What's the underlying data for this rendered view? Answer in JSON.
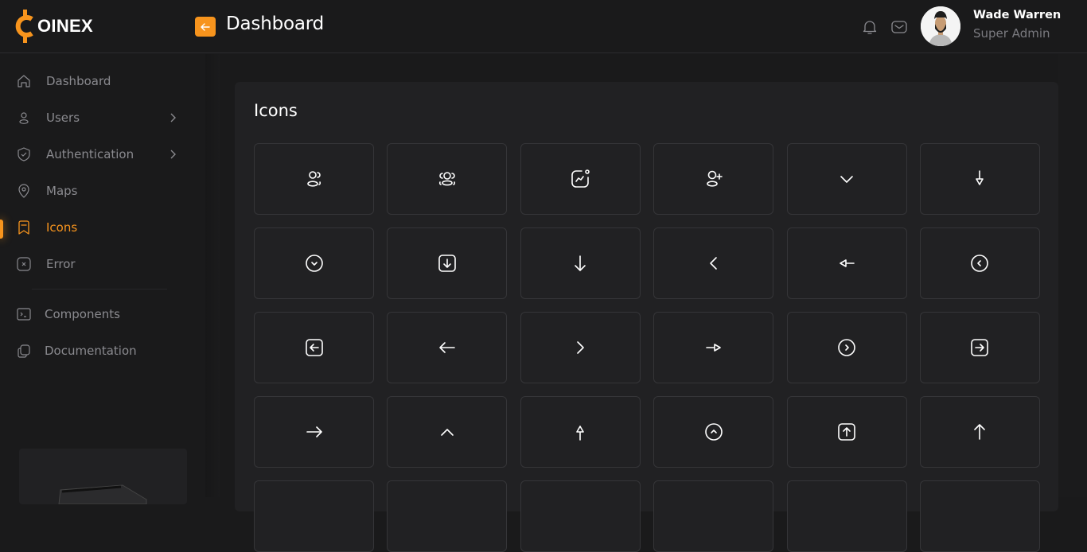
{
  "brand": {
    "name": "OINEX",
    "logo_letter": "C",
    "accent": "#f7941d"
  },
  "header": {
    "title": "Dashboard",
    "back_icon": "arrow-left-icon",
    "notification_icon": "bell-icon",
    "mail_icon": "mail-icon"
  },
  "user": {
    "name": "Wade Warren",
    "role": "Super Admin"
  },
  "sidebar": {
    "items": [
      {
        "label": "Dashboard",
        "icon": "home-icon",
        "has_children": false,
        "active": false
      },
      {
        "label": "Users",
        "icon": "user-icon",
        "has_children": true,
        "active": false
      },
      {
        "label": "Authentication",
        "icon": "shield-check-icon",
        "has_children": true,
        "active": false
      },
      {
        "label": "Maps",
        "icon": "map-pin-icon",
        "has_children": false,
        "active": false
      },
      {
        "label": "Icons",
        "icon": "bookmark-icon",
        "has_children": false,
        "active": true
      },
      {
        "label": "Error",
        "icon": "x-square-icon",
        "has_children": false,
        "active": false
      }
    ],
    "secondary_items": [
      {
        "label": "Components",
        "icon": "terminal-icon"
      },
      {
        "label": "Documentation",
        "icon": "copy-icon"
      }
    ]
  },
  "panel": {
    "title": "Icons",
    "icons": [
      "users-icon",
      "users-group-icon",
      "chart-notification-icon",
      "user-add-icon",
      "chevron-down-icon",
      "arrow-down-triangle-icon",
      "chevron-down-circle-icon",
      "arrow-down-square-icon",
      "arrow-down-icon",
      "chevron-left-icon",
      "arrow-left-triangle-icon",
      "chevron-left-circle-icon",
      "arrow-left-square-icon",
      "arrow-left-icon",
      "chevron-right-icon",
      "arrow-right-triangle-icon",
      "chevron-right-circle-icon",
      "arrow-right-square-icon",
      "arrow-right-icon",
      "chevron-up-icon",
      "arrow-up-triangle-icon",
      "chevron-up-circle-icon",
      "arrow-up-square-icon",
      "arrow-up-icon",
      "icon-placeholder",
      "icon-placeholder",
      "icon-placeholder",
      "icon-placeholder",
      "icon-placeholder",
      "icon-placeholder"
    ]
  }
}
